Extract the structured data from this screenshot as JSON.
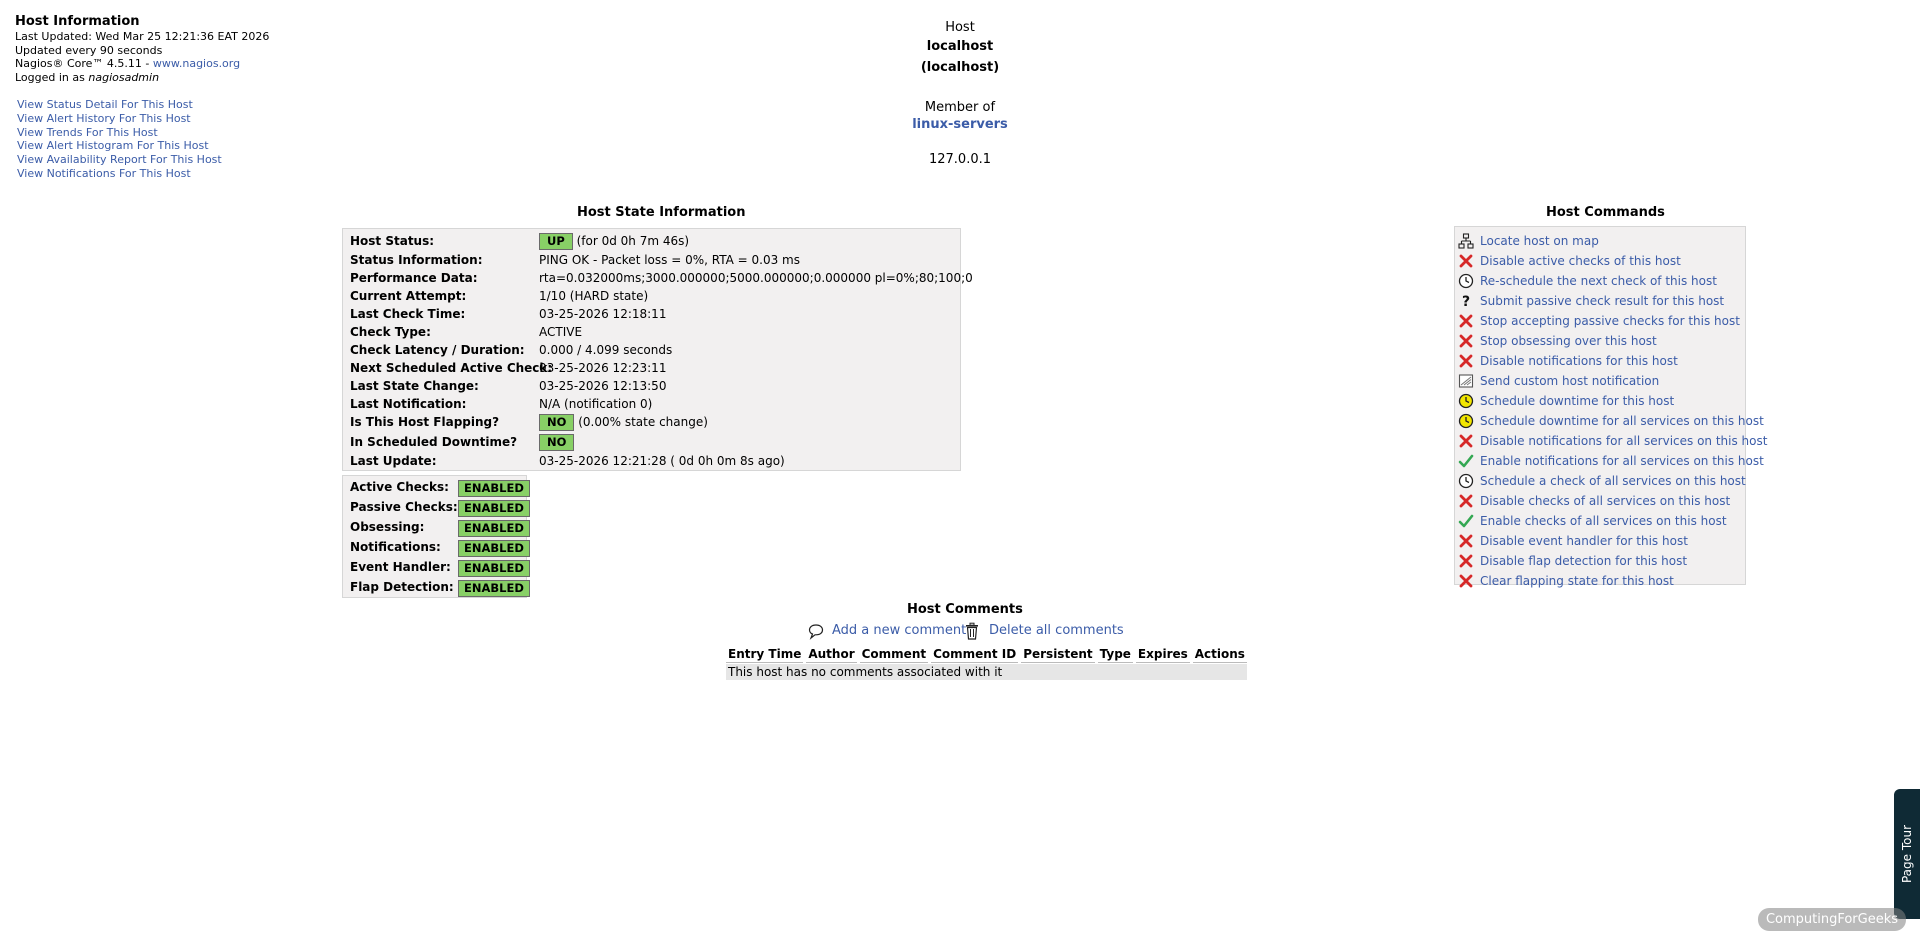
{
  "info": {
    "title": "Host Information",
    "last_updated": "Last Updated: Wed Mar 25 12:21:36 EAT 2026",
    "update_every": "Updated every 90 seconds",
    "version_prefix": "Nagios® Core™ 4.5.11 - ",
    "version_link": "www.nagios.org",
    "logged_prefix": "Logged in as ",
    "user": "nagiosadmin"
  },
  "links": [
    "View Status Detail For This Host",
    "View Alert History For This Host",
    "View Trends For This Host",
    "View Alert Histogram For This Host",
    "View Availability Report For This Host",
    "View Notifications For This Host"
  ],
  "host": {
    "label": "Host",
    "name": "localhost",
    "alias": "(localhost)",
    "member_of": "Member of",
    "group": "linux-servers",
    "address": "127.0.0.1"
  },
  "state_title": "Host State Information",
  "state": {
    "status_label": "Host Status:",
    "status_badge": "UP",
    "status_duration": "(for 0d 0h 7m 46s)",
    "info_label": "Status Information:",
    "info": "PING OK - Packet loss = 0%, RTA = 0.03 ms",
    "perf_label": "Performance Data:",
    "perf": "rta=0.032000ms;3000.000000;5000.000000;0.000000 pl=0%;80;100;0",
    "attempt_label": "Current Attempt:",
    "attempt": "1/10  (HARD state)",
    "lastcheck_label": "Last Check Time:",
    "lastcheck": "03-25-2026 12:18:11",
    "type_label": "Check Type:",
    "type": "ACTIVE",
    "latency_label": "Check Latency / Duration:",
    "latency": "0.000 / 4.099 seconds",
    "next_label": "Next Scheduled Active Check:",
    "next": "03-25-2026 12:23:11",
    "change_label": "Last State Change:",
    "change": "03-25-2026 12:13:50",
    "notif_label": "Last Notification:",
    "notif": "N/A (notification 0)",
    "flap_label": "Is This Host Flapping?",
    "flap_badge": "NO",
    "flap_pct": "(0.00% state change)",
    "downtime_label": "In Scheduled Downtime?",
    "downtime_badge": "NO",
    "update_label": "Last Update:",
    "update": "03-25-2026 12:21:28  ( 0d 0h 0m 8s ago)"
  },
  "checks": [
    {
      "label": "Active Checks:",
      "value": "ENABLED"
    },
    {
      "label": "Passive Checks:",
      "value": "ENABLED"
    },
    {
      "label": "Obsessing:",
      "value": "ENABLED"
    },
    {
      "label": "Notifications:",
      "value": "ENABLED"
    },
    {
      "label": "Event Handler:",
      "value": "ENABLED"
    },
    {
      "label": "Flap Detection:",
      "value": "ENABLED"
    }
  ],
  "commands_title": "Host Commands",
  "commands": [
    {
      "icon": "network-map-icon",
      "label": "Locate host on map"
    },
    {
      "icon": "red-x-icon",
      "label": "Disable active checks of this host"
    },
    {
      "icon": "clock-icon",
      "label": "Re-schedule the next check of this host"
    },
    {
      "icon": "question-icon",
      "label": "Submit passive check result for this host"
    },
    {
      "icon": "red-x-icon",
      "label": "Stop accepting passive checks for this host"
    },
    {
      "icon": "red-x-icon",
      "label": "Stop obsessing over this host"
    },
    {
      "icon": "red-x-icon",
      "label": "Disable notifications for this host"
    },
    {
      "icon": "notification-icon",
      "label": "Send custom host notification"
    },
    {
      "icon": "yellow-clock-icon",
      "label": "Schedule downtime for this host"
    },
    {
      "icon": "yellow-clock-icon",
      "label": "Schedule downtime for all services on this host"
    },
    {
      "icon": "red-x-icon",
      "label": "Disable notifications for all services on this host"
    },
    {
      "icon": "green-check-icon",
      "label": "Enable notifications for all services on this host"
    },
    {
      "icon": "clock-icon",
      "label": "Schedule a check of all services on this host"
    },
    {
      "icon": "red-x-icon",
      "label": "Disable checks of all services on this host"
    },
    {
      "icon": "green-check-icon",
      "label": "Enable checks of all services on this host"
    },
    {
      "icon": "red-x-icon",
      "label": "Disable event handler for this host"
    },
    {
      "icon": "red-x-icon",
      "label": "Disable flap detection for this host"
    },
    {
      "icon": "red-x-icon",
      "label": "Clear flapping state for this host"
    }
  ],
  "comments": {
    "title": "Host Comments",
    "add": "Add a new comment",
    "delete": "Delete all comments",
    "columns": [
      "Entry Time",
      "Author",
      "Comment",
      "Comment ID",
      "Persistent",
      "Type",
      "Expires",
      "Actions"
    ],
    "empty": "This host has no comments associated with it"
  },
  "tour_label": "Page Tour",
  "watermark": "ComputingForGeeks",
  "colors": {
    "enabled": "#88d066",
    "link": "#3b5ca8",
    "panel": "#f2f0f0",
    "error_red": "#d62828",
    "ok_green": "#34a853"
  }
}
